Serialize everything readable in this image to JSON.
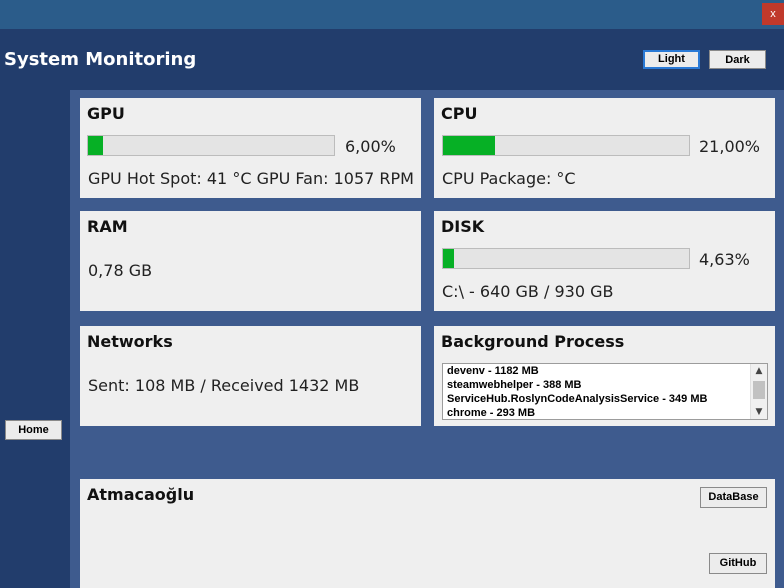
{
  "window": {
    "close_glyph": "x"
  },
  "header": {
    "title": "System Monitoring",
    "light_label": "Light",
    "dark_label": "Dark"
  },
  "sidebar": {
    "home_label": "Home"
  },
  "gpu": {
    "title": "GPU",
    "usage_percent": 6.0,
    "usage_text": "6,00%",
    "info": "GPU Hot Spot: 41 °C  GPU Fan: 1057 RPM"
  },
  "cpu": {
    "title": "CPU",
    "usage_percent": 21.0,
    "usage_text": "21,00%",
    "info": "CPU Package:  °C"
  },
  "ram": {
    "title": "RAM",
    "value": "0,78 GB"
  },
  "disk": {
    "title": "DISK",
    "usage_percent": 4.63,
    "usage_text": "4,63%",
    "info": "C:\\ - 640 GB / 930 GB"
  },
  "networks": {
    "title": "Networks",
    "info": "Sent: 108 MB / Received  1432 MB"
  },
  "background": {
    "title": "Background Process",
    "items": [
      "devenv - 1182 MB",
      "steamwebhelper - 388 MB",
      "ServiceHub.RoslynCodeAnalysisService - 349 MB",
      "chrome - 293 MB"
    ]
  },
  "footer": {
    "author": "Atmacaoğlu",
    "database_label": "DataBase",
    "github_label": "GitHub"
  },
  "colors": {
    "accent_bar": "#06b025",
    "panel": "#efefef",
    "background": "#223d6c",
    "main_area": "#3e5b8e"
  }
}
